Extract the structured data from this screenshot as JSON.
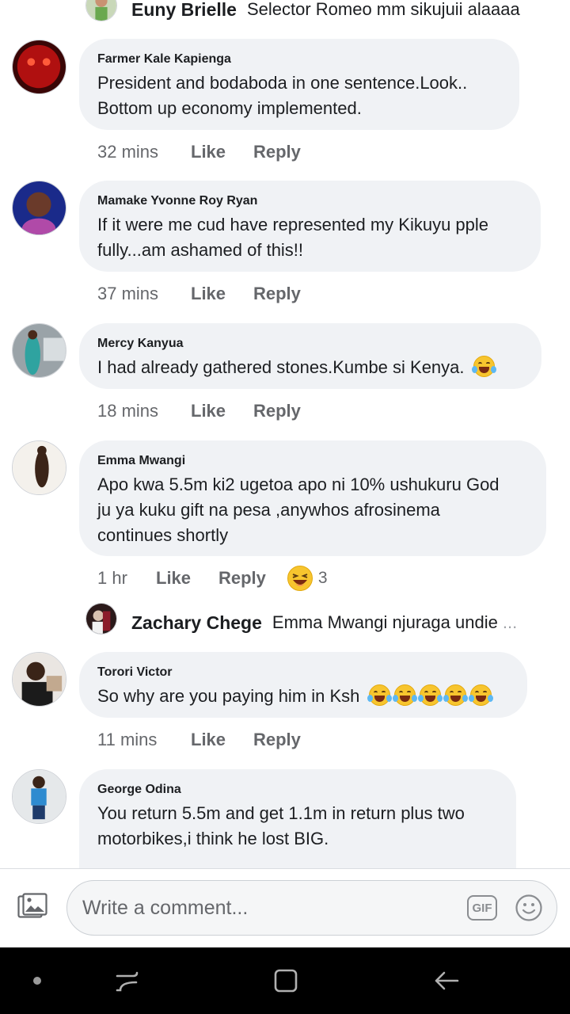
{
  "top_reply": {
    "name": "Euny Brielle",
    "text": "Selector Romeo mm sikujuii alaaaa"
  },
  "comments": [
    {
      "name": "Farmer Kale Kapienga",
      "lines": [
        "President and bodaboda in one sentence.Look..",
        "Bottom up economy implemented."
      ],
      "time": "32 mins"
    },
    {
      "name": "Mamake Yvonne Roy Ryan",
      "lines": [
        "If it were me cud have represented my Kikuyu pple",
        "fully...am ashamed of this!!"
      ],
      "time": "37 mins"
    },
    {
      "name": "Mercy Kanyua",
      "lines": [
        "I had already gathered stones.Kumbe si Kenya."
      ],
      "time": "18 mins"
    },
    {
      "name": "Emma Mwangi",
      "lines": [
        "Apo kwa 5.5m ki2 ugetoa apo ni 10% ushukuru God",
        "ju ya kuku gift na pesa ,anywhos afrosinema",
        "continues shortly"
      ],
      "time": "1 hr",
      "reaction_count": "3"
    },
    {
      "name": "Torori Victor",
      "lines": [
        "So why are you paying him in Ksh"
      ],
      "time": "11 mins"
    },
    {
      "name": "George Odina",
      "lines": [
        "You return 5.5m and get 1.1m in return plus two",
        "motorbikes,i think he lost BIG."
      ]
    }
  ],
  "inline_reply": {
    "name": "Zachary Chege",
    "text": "Emma Mwangi njuraga undie",
    "more": "..."
  },
  "actions": {
    "like": "Like",
    "reply": "Reply"
  },
  "composer": {
    "placeholder": "Write a comment...",
    "gif_label": "GIF"
  },
  "icons": {
    "photo": "photo-icon",
    "gif": "gif-icon",
    "smile": "smiley-icon",
    "emoji": "laughing-crying-emoji-icon",
    "reaction": "haha-reaction-icon",
    "nav": [
      "nav-dot-icon",
      "recent-apps-icon",
      "home-icon",
      "back-icon"
    ]
  },
  "colors": {
    "bubble": "#f0f2f5",
    "meta": "#65676b",
    "text": "#1c1e21",
    "navbar": "#000000"
  }
}
